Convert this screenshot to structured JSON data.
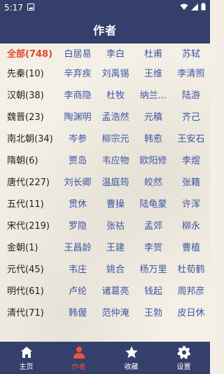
{
  "status_bar": {
    "time": "5:17"
  },
  "app_bar": {
    "title": "作者"
  },
  "rows": [
    {
      "dynasty": "全部(748)",
      "active": true,
      "authors": [
        "白居易",
        "李白",
        "杜甫",
        "苏轼"
      ]
    },
    {
      "dynasty": "先秦(10)",
      "authors": [
        "辛弃疾",
        "刘禹锡",
        "王维",
        "李清照"
      ]
    },
    {
      "dynasty": "汉朝(38)",
      "authors": [
        "李商隐",
        "杜牧",
        "纳兰...",
        "陆游"
      ]
    },
    {
      "dynasty": "魏晋(23)",
      "authors": [
        "陶渊明",
        "孟浩然",
        "元稹",
        "齐己"
      ]
    },
    {
      "dynasty": "南北朝(34)",
      "authors": [
        "岑参",
        "柳宗元",
        "韩愈",
        "王安石"
      ]
    },
    {
      "dynasty": "隋朝(6)",
      "authors": [
        "贾岛",
        "韦应物",
        "欧阳修",
        "李煜"
      ]
    },
    {
      "dynasty": "唐代(227)",
      "authors": [
        "刘长卿",
        "温庭筠",
        "皎然",
        "张籍"
      ]
    },
    {
      "dynasty": "五代(11)",
      "authors": [
        "贯休",
        "曹操",
        "陆龟蒙",
        "许浑"
      ]
    },
    {
      "dynasty": "宋代(219)",
      "authors": [
        "罗隐",
        "张祜",
        "孟郊",
        "柳永"
      ]
    },
    {
      "dynasty": "金朝(1)",
      "authors": [
        "王昌龄",
        "王建",
        "李贺",
        "曹植"
      ]
    },
    {
      "dynasty": "元代(45)",
      "authors": [
        "韦庄",
        "姚合",
        "杨万里",
        "杜荀鹤"
      ]
    },
    {
      "dynasty": "明代(61)",
      "authors": [
        "卢纶",
        "诸葛亮",
        "钱起",
        "周邦彦"
      ]
    },
    {
      "dynasty": "清代(71)",
      "authors": [
        "韩偓",
        "范仲淹",
        "王勃",
        "皮日休"
      ]
    }
  ],
  "bottom_nav": {
    "items": [
      {
        "label": "主页",
        "icon": "home-icon"
      },
      {
        "label": "作者",
        "icon": "person-icon",
        "active": true
      },
      {
        "label": "收藏",
        "icon": "star-icon"
      },
      {
        "label": "设置",
        "icon": "gear-icon"
      }
    ]
  },
  "colors": {
    "bar": "#34406b",
    "accent": "#e0492b",
    "author_text": "#3c56a3",
    "background": "#f4f0e7"
  }
}
